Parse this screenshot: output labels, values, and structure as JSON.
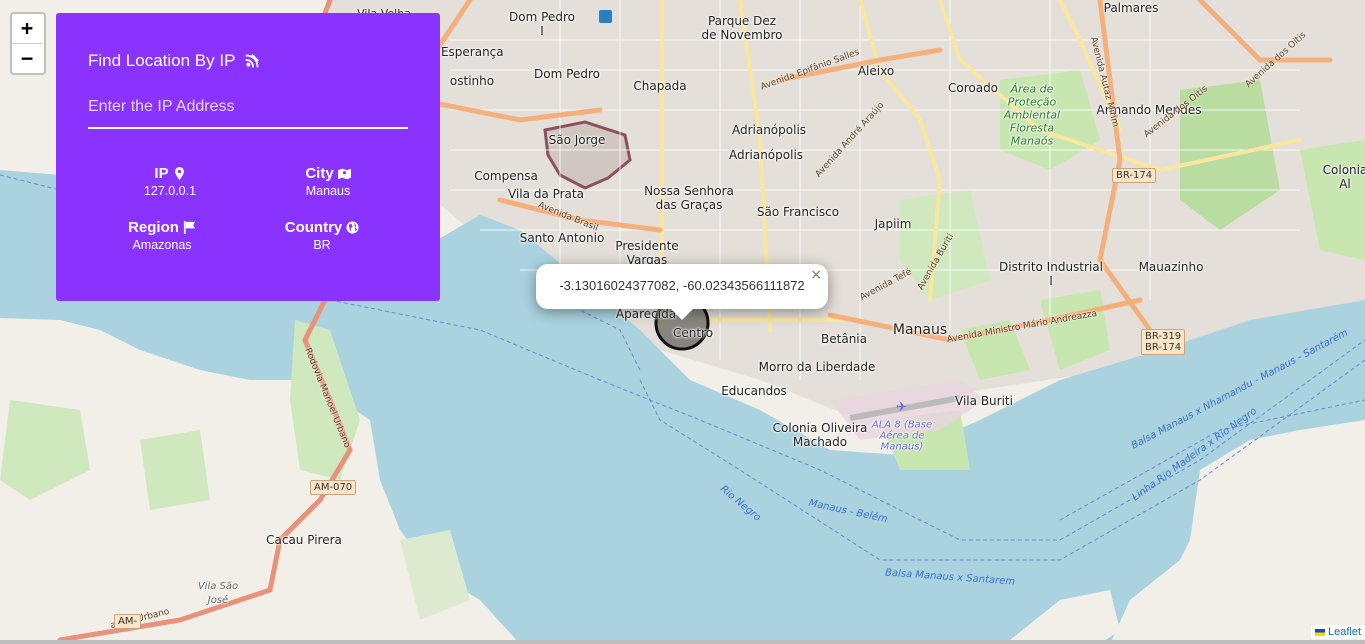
{
  "zoom": {
    "in_label": "+",
    "out_label": "−"
  },
  "panel": {
    "title": "Find Location By IP",
    "input_placeholder": "Enter the IP Address",
    "ip_label": "IP",
    "ip_value": "127.0.0.1",
    "city_label": "City",
    "city_value": "Manaus",
    "region_label": "Region",
    "region_value": "Amazonas",
    "country_label": "Country",
    "country_value": "BR",
    "bg_color": "#8a33ff"
  },
  "popup": {
    "text": "-3.13016024377082, -60.02343566111872",
    "close": "×"
  },
  "attribution": "Leaflet",
  "map": {
    "places": {
      "dom_pedro_1": "Dom Pedro\nI",
      "parque_dez": "Parque Dez\nde Novembro",
      "palmares": "Palmares",
      "nova_esperanca": "Nova Esperança",
      "dom_pedro": "Dom Pedro",
      "chapada": "Chapada",
      "aleixo": "Aleixo",
      "coroado": "Coroado",
      "armando_mendes": "Armando Mendes",
      "sao_jorge": "São Jorge",
      "adrianopolis_1": "Adrianópolis",
      "adrianopolis_2": "Adrianópolis",
      "compensa": "Compensa",
      "vila_da_prata": "Vila da Prata",
      "nossa_senhora": "Nossa Senhora\ndas Graças",
      "sao_francisco": "São Francisco",
      "japiim": "Japiim",
      "santo_antonio": "Santo Antonio",
      "presidente_vargas": "Presidente\nVargas",
      "distrito_industrial": "Distrito Industrial\nI",
      "mauazinho": "Mauazinho",
      "colonia_al": "Colonia\nAl",
      "aparecida": "Aparecida",
      "centro": "Centro",
      "manaus": "Manaus",
      "betania": "Betânia",
      "morro": "Morro da Liberdade",
      "educandos": "Educandos",
      "vila_buriti": "Vila Buriti",
      "colonia_oliveira": "Colonia Oliveira\nMachado",
      "cacau_pirera": "Cacau Pirera",
      "vila_sao_jose": "Vila São\nJosé",
      "rostinho": "ostinho",
      "area_protecao": "Área de\nProteção\nAmbiental\nFloresta\nManaós",
      "ala8": "ALA 8 (Base\nAérea de\nManaus)",
      "rio_negro": "Rio Negro",
      "manaus_belem": "Manaus - Belém",
      "balsa_santarem": "Balsa Manaus x Santarem",
      "av_brasil": "Avenida Brasil",
      "av_epifanio": "Avenida Epifânio Salles",
      "av_andre": "Avenida André Araújo",
      "av_buriti": "Avenida Buriti",
      "av_tefe": "Avenida Tefé",
      "av_mario": "Avenida Ministro Mário Andreazza",
      "av_autaz": "Avenida Autaz Mirim",
      "av_otis": "Avenida dos Oitis",
      "rod_manoel": "Rodovia Manoel Urbano",
      "manoel_urbano_2": "anoel Urbano",
      "balsa_nhamundu": "Balsa Manaus x Nhamandu - Manaus - Santarém",
      "linha_rio_madeira": "Linha Rio Madeira x Rio Negro",
      "vila_velha": "Vila Velha"
    },
    "shields": {
      "br174": "BR-174",
      "br319": "BR-319\nBR-174",
      "am070": "AM-070",
      "am": "AM-"
    }
  }
}
